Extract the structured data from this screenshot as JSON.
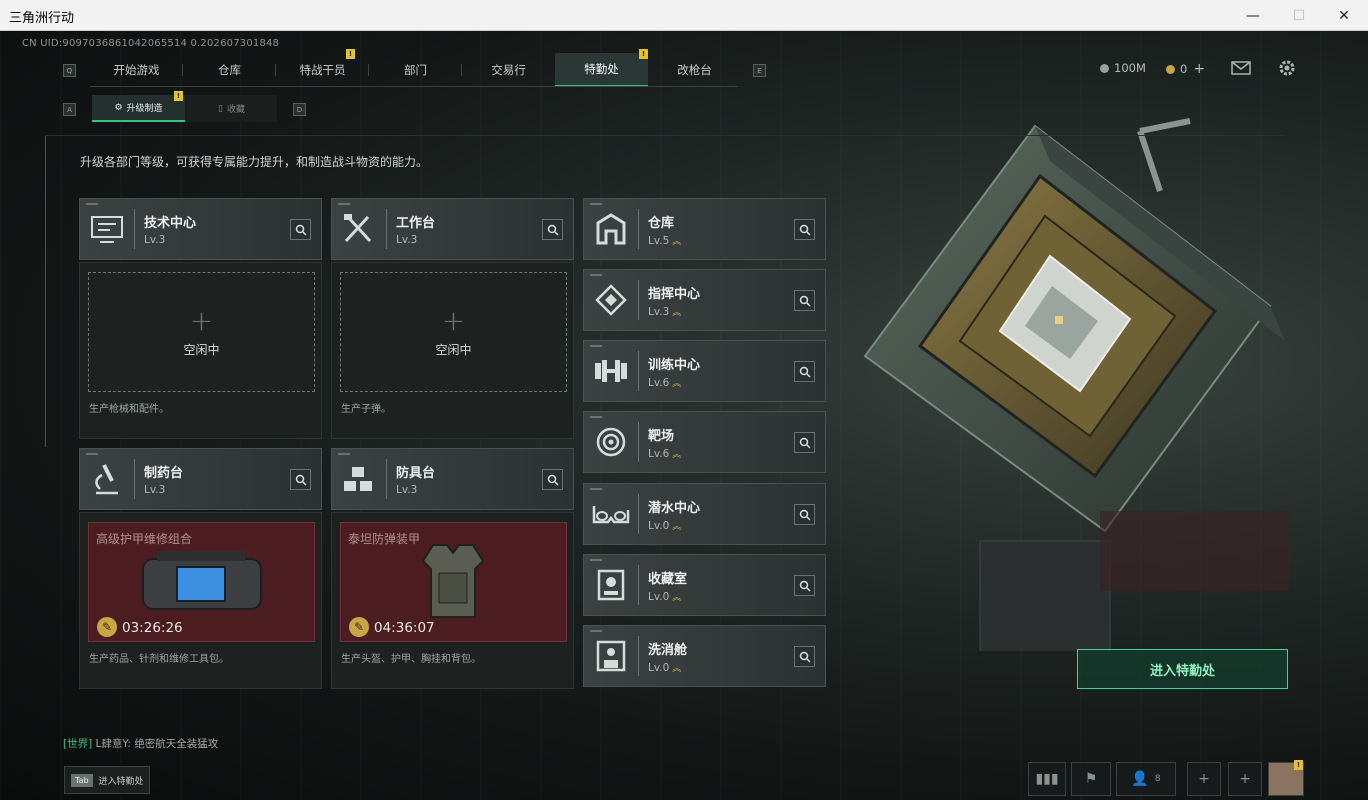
{
  "window": {
    "title": "三角洲行动",
    "minimize": "—",
    "maximize": "☐",
    "close": "✕"
  },
  "uid": "CN UID:9097036861042065514 0.202607301848",
  "keys": {
    "left": "Q",
    "right": "E",
    "sub_left": "A",
    "sub_right": "D"
  },
  "tabs": [
    "开始游戏",
    "仓库",
    "特战干员",
    "部门",
    "交易行",
    "特勤处",
    "改枪台"
  ],
  "active_tab": "特勤处",
  "resources": {
    "money": "100M",
    "coin": "0",
    "plus": "+"
  },
  "subtabs": {
    "upgrade": "升级制造",
    "collect": "收藏"
  },
  "description": "升级各部门等级，可获得专属能力提升，和制造战斗物资的能力。",
  "stations": [
    {
      "name": "技术中心",
      "level": "Lv.3",
      "status": "空闲中",
      "caption": "生产枪械和配件。",
      "icon": "tech-center-icon"
    },
    {
      "name": "工作台",
      "level": "Lv.3",
      "status": "空闲中",
      "caption": "生产子弹。",
      "icon": "workbench-icon"
    },
    {
      "name": "制药台",
      "level": "Lv.3",
      "item": "高级护甲维修组合",
      "timer": "03:26:26",
      "caption": "生产药品、针剂和维修工具包。",
      "icon": "microscope-icon"
    },
    {
      "name": "防具台",
      "level": "Lv.3",
      "item": "泰坦防弹装甲",
      "timer": "04:36:07",
      "caption": "生产头盔、护甲、胸挂和背包。",
      "icon": "armor-bench-icon"
    }
  ],
  "facilities": [
    {
      "name": "仓库",
      "level": "Lv.5",
      "icon": "warehouse-icon"
    },
    {
      "name": "指挥中心",
      "level": "Lv.3",
      "icon": "command-center-icon"
    },
    {
      "name": "训练中心",
      "level": "Lv.6",
      "icon": "dumbbell-icon"
    },
    {
      "name": "靶场",
      "level": "Lv.6",
      "icon": "target-icon"
    },
    {
      "name": "潜水中心",
      "level": "Lv.0",
      "icon": "diving-goggles-icon"
    },
    {
      "name": "收藏室",
      "level": "Lv.0",
      "icon": "collection-room-icon"
    },
    {
      "name": "洗消舱",
      "level": "Lv.0",
      "icon": "decontamination-icon"
    }
  ],
  "enter_button": "进入特勤处",
  "chat": {
    "channel": "[世界]",
    "user": "L肆意Y:",
    "message": "绝密航天全装猛攻"
  },
  "tab_hint": {
    "key": "Tab",
    "label": "进入特勤处"
  },
  "friends_count": "8",
  "colors": {
    "accent": "#2fc77e",
    "badge": "#e4c02d",
    "craft_bg": "#4b1d20"
  }
}
